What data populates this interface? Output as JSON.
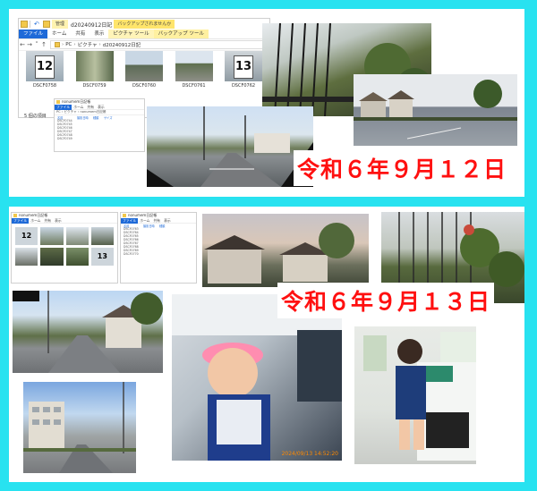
{
  "top": {
    "explorer": {
      "title": "d20240912日記",
      "context_tab_manage": "管理",
      "context_tab_backup": "バックアップされませんか",
      "ribbon": [
        "ファイル",
        "ホーム",
        "共有",
        "表示",
        "ピクチャ ツール",
        "バックアップ ツール"
      ],
      "address": [
        "PC",
        "ピクチャ",
        "d20240912日記"
      ],
      "files": [
        {
          "name": "DSCF0758",
          "sign": "12"
        },
        {
          "name": "DSCF0759",
          "sign": ""
        },
        {
          "name": "DSCF0760",
          "sign": ""
        },
        {
          "name": "DSCF0761",
          "sign": ""
        },
        {
          "name": "DSCF0762",
          "sign": "13"
        }
      ],
      "status": "5 個の項目"
    },
    "small_list": {
      "title": "nonumem日記帳",
      "ribbon": [
        "ファイル",
        "ホーム",
        "共有",
        "表示"
      ],
      "address": "PC › ピクチャ › nonumem日記帳",
      "columns": [
        "名前",
        "撮影日時",
        "種類",
        "サイズ"
      ],
      "rows": [
        "DSCF0744",
        "DSCF0745",
        "DSCF0746",
        "DSCF0747",
        "DSCF0748",
        "DSCF0749"
      ]
    },
    "banner": "令和６年９月１２日"
  },
  "bottom": {
    "explorer_left": {
      "title": "nonumem日記帳",
      "files": [
        "12",
        "",
        "",
        "",
        "",
        "",
        "",
        "13"
      ]
    },
    "explorer_right": {
      "title": "nonumem日記帳",
      "columns": [
        "名前",
        "撮影日時",
        "種類",
        "サイズ"
      ],
      "rows": [
        "DSCF0763",
        "DSCF0764",
        "DSCF0765",
        "DSCF0766",
        "DSCF0767",
        "DSCF0768",
        "DSCF0769",
        "DSCF0770"
      ]
    },
    "banner": "令和６年９月１３日",
    "timestamp": "2024/09/13  14:52:20"
  },
  "colors": {
    "frame": "#28e2f0",
    "banner_text": "#ff1010",
    "explorer_file_tab": "#1e6ad8"
  }
}
